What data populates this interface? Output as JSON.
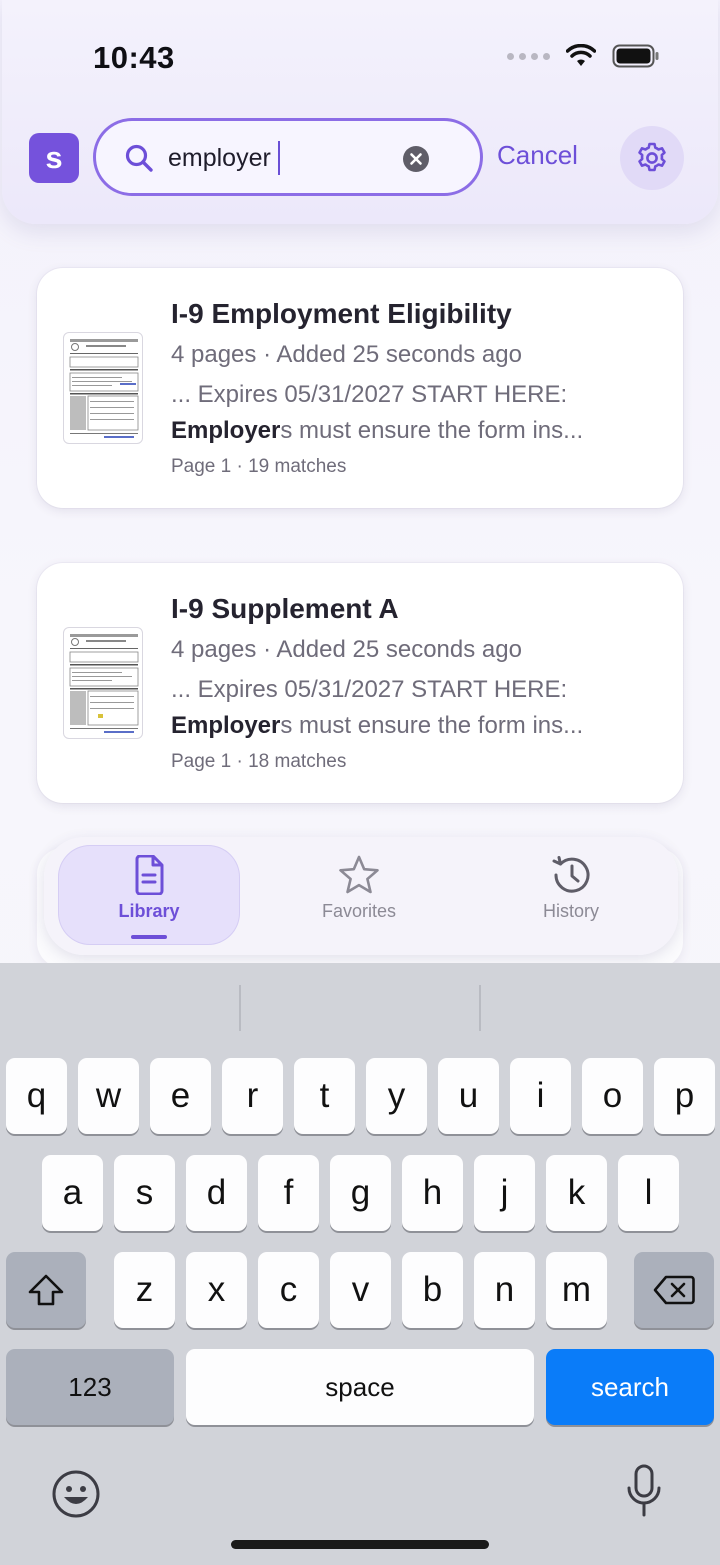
{
  "status_bar": {
    "time": "10:43"
  },
  "header": {
    "logo_letter": "s",
    "search": {
      "value": "employer",
      "cancel_label": "Cancel"
    }
  },
  "results": [
    {
      "title": "I-9 Employment Eligibility",
      "meta": "4 pages · Added 25 seconds ago",
      "snippet_line1": "... Expires 05/31/2027 START HERE:",
      "snippet_highlight": "Employer",
      "snippet_rest": "s must ensure the form ins...",
      "page_info": "Page 1 · 19 matches"
    },
    {
      "title": "I-9 Supplement A",
      "meta": "4 pages · Added 25 seconds ago",
      "snippet_line1": "... Expires 05/31/2027 START HERE:",
      "snippet_highlight": "Employer",
      "snippet_rest": "s must ensure the form ins...",
      "page_info": "Page 1 · 18 matches"
    }
  ],
  "tab_bar": {
    "tabs": [
      {
        "label": "Library",
        "icon": "document-icon",
        "active": true
      },
      {
        "label": "Favorites",
        "icon": "star-icon",
        "active": false
      },
      {
        "label": "History",
        "icon": "clock-history-icon",
        "active": false
      }
    ]
  },
  "keyboard": {
    "row1": [
      "q",
      "w",
      "e",
      "r",
      "t",
      "y",
      "u",
      "i",
      "o",
      "p"
    ],
    "row2": [
      "a",
      "s",
      "d",
      "f",
      "g",
      "h",
      "j",
      "k",
      "l"
    ],
    "row3": [
      "z",
      "x",
      "c",
      "v",
      "b",
      "n",
      "m"
    ],
    "numbers_label": "123",
    "space_label": "space",
    "search_label": "search"
  },
  "colors": {
    "accent": "#6d4fd8",
    "logo": "#7552dc",
    "search_key": "#0a7cf9"
  }
}
